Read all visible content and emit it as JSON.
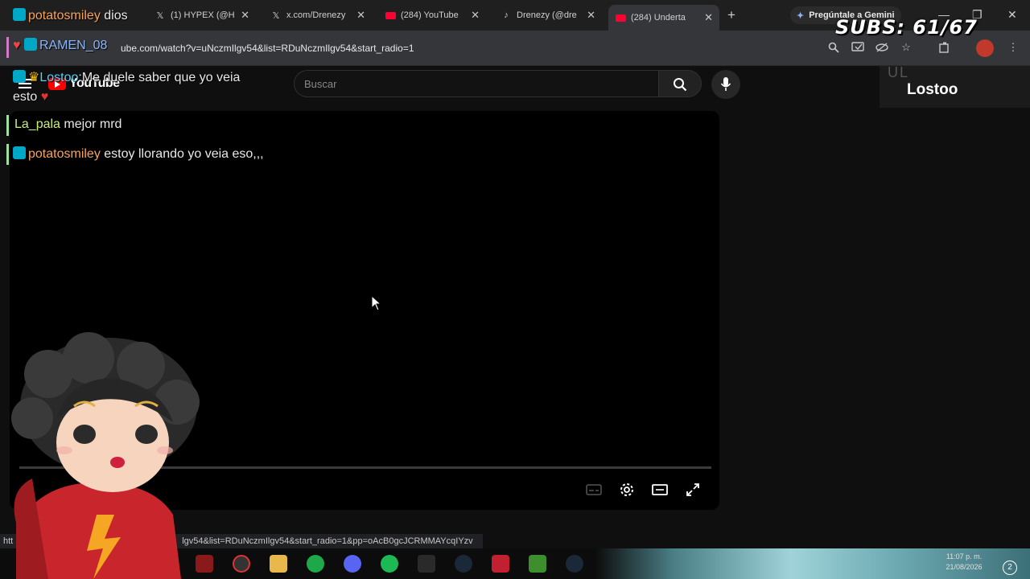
{
  "browser": {
    "tabs": [
      {
        "label": "(1) HYPEX (@H",
        "icon": "x-logo-icon"
      },
      {
        "label": "x.com/Drenezy",
        "icon": "x-logo-icon"
      },
      {
        "label": "(284) YouTube",
        "icon": "youtube-icon"
      },
      {
        "label": "Drenezy (@dre",
        "icon": "tiktok-icon"
      },
      {
        "label": "(284) Underta",
        "icon": "youtube-icon"
      }
    ],
    "gemini_label": "Pregúntale a Gemini",
    "url": "ube.com/watch?v=uNczmIlgv54&list=RDuNczmIlgv54&start_radio=1"
  },
  "youtube": {
    "logo_text": "YouTube",
    "search_placeholder": "Buscar"
  },
  "overlay": {
    "subs": "SUBS: 61/67",
    "watermark": "UL",
    "streamer_label": "Lostoo",
    "chat": [
      {
        "user": "potatosmiley",
        "message": "dios"
      },
      {
        "user": "RAMEN_08",
        "message": ""
      },
      {
        "user": "Lostoo",
        "message": "Me duele saber que yo veia",
        "message_cont": "esto"
      },
      {
        "user": "La_pala",
        "message": "mejor mrd"
      },
      {
        "user": "potatosmiley",
        "message": "estoy llorando yo veia eso,,,"
      }
    ]
  },
  "status_bar": {
    "left": "htt",
    "url": "lgv54&list=RDuNczmIlgv54&start_radio=1&pp=oAcB0gcJCRMMAYcqIYzv"
  },
  "taskbar": {
    "time": "11:07 p. m.",
    "date": "21/08/2026",
    "notifications": "2"
  }
}
